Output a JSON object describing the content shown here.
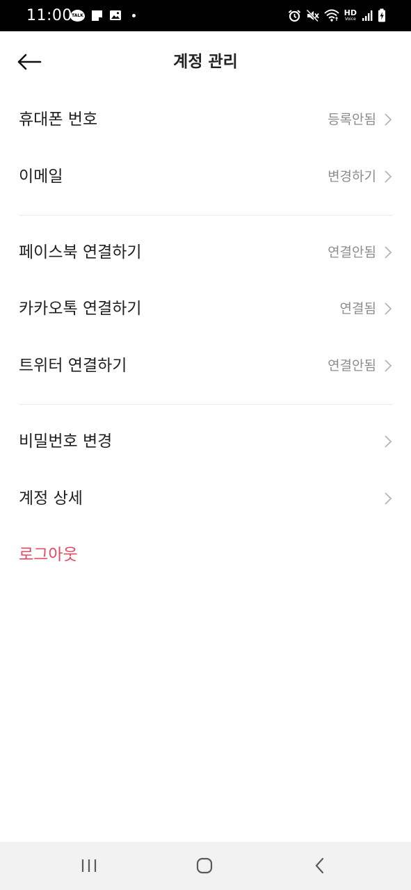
{
  "status_bar": {
    "time": "11:00",
    "talk_badge": "TALK",
    "network_label": "HD",
    "network_sub": "Voice",
    "left_icons": [
      "talk-icon",
      "sticky-note-icon",
      "gallery-icon",
      "dot-icon"
    ],
    "right_icons": [
      "alarm-icon",
      "mute-icon",
      "wifi-icon",
      "hd-voice-icon",
      "signal-icon",
      "battery-charging-icon"
    ]
  },
  "header": {
    "title": "계정 관리",
    "back_icon": "arrow-left-icon"
  },
  "sections": {
    "contact": [
      {
        "label": "휴대폰 번호",
        "value": "등록안됨"
      },
      {
        "label": "이메일",
        "value": "변경하기"
      }
    ],
    "social": [
      {
        "label": "페이스북 연결하기",
        "value": "연결안됨"
      },
      {
        "label": "카카오톡 연결하기",
        "value": "연결됨"
      },
      {
        "label": "트위터 연결하기",
        "value": "연결안됨"
      }
    ],
    "account": [
      {
        "label": "비밀번호 변경",
        "value": ""
      },
      {
        "label": "계정 상세",
        "value": ""
      }
    ]
  },
  "logout": {
    "label": "로그아웃",
    "color": "#e8485f"
  },
  "nav_bar": {
    "icons": [
      "recent-apps-icon",
      "home-icon",
      "back-icon"
    ]
  }
}
